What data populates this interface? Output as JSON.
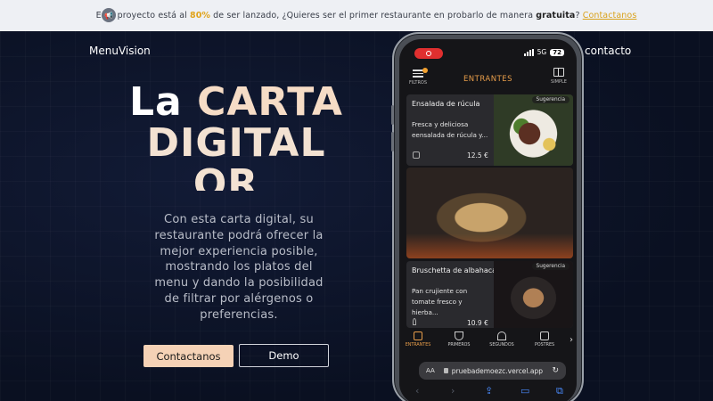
{
  "banner": {
    "icon": "megaphone-icon",
    "prefix": "Este proyecto está al ",
    "percent": "80%",
    "middle": " de ser lanzado, ¿Quieres ser el primer restaurante en probarlo de manera ",
    "bold": "gratuita",
    "question_end": "? ",
    "link": "Contactanos"
  },
  "nav": {
    "brand": "MenuVision",
    "contact": "contacto"
  },
  "hero": {
    "headline_1": "La ",
    "headline_2": "CARTA",
    "headline_3": "DIGITAL",
    "headline_4": "QR",
    "cursor": "_",
    "description": "Con esta carta digital, su restaurante podrá ofrecer la mejor experiencia posible, mostrando los platos del menu y dando la posibilidad de filtrar por alérgenos o preferencias.",
    "primary_button": "Contactanos",
    "secondary_button": "Demo"
  },
  "phone": {
    "network": "5G",
    "battery": "72",
    "app_title": "ENTRANTES",
    "filter_label": "FILTROS",
    "simple_label": "SIMPLE",
    "suggestion_label": "Sugerencia",
    "dishes": [
      {
        "name": "Ensalada de rúcula",
        "desc_1": "Fresca y deliciosa",
        "desc_2": "eensalada de rúcula y...",
        "price": "12.5 €"
      },
      {
        "name": "Bruschetta de albahaca",
        "desc_1": "Pan crujiente con",
        "desc_2": "tomate fresco y hierba...",
        "price": "10.9 €"
      }
    ],
    "tabs": [
      {
        "label": "ENTRANTES",
        "icon": "grain-icon",
        "active": true
      },
      {
        "label": "PRIMEROS",
        "icon": "bowl-icon",
        "active": false
      },
      {
        "label": "SEGUNDOS",
        "icon": "cloche-icon",
        "active": false
      },
      {
        "label": "POSTRES",
        "icon": "cake-icon",
        "active": false
      }
    ],
    "url": "pruebademoezc.vercel.app",
    "url_aa": "AA"
  },
  "colors": {
    "accent_orange": "#e79d4a",
    "peach_button": "#f5d2b6",
    "banner_highlight": "#e0a31a",
    "background": "#0b1224"
  }
}
